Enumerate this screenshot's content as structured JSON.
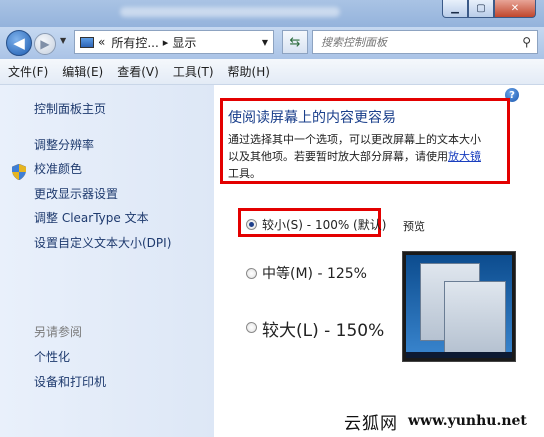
{
  "address": {
    "overflow": "«",
    "crumbs": [
      "所有控...",
      "显示"
    ]
  },
  "search": {
    "placeholder": "搜索控制面板"
  },
  "menu": [
    "文件(F)",
    "编辑(E)",
    "查看(V)",
    "工具(T)",
    "帮助(H)"
  ],
  "sidebar": {
    "items": [
      "控制面板主页",
      "调整分辨率",
      "校准颜色",
      "更改显示器设置",
      "调整 ClearType 文本",
      "设置自定义文本大小(DPI)"
    ],
    "see_also_title": "另请参阅",
    "see_also": [
      "个性化",
      "设备和打印机"
    ]
  },
  "main": {
    "heading": "使阅读屏幕上的内容更容易",
    "desc_line1": "通过选择其中一个选项，可以更改屏幕上的文本大小",
    "desc_line2a": "以及其他项。若要暂时放大部分屏幕，请使用",
    "desc_link": "放大镜",
    "desc_line3": "工具。",
    "preview_label": "预览",
    "options": [
      {
        "label": "较小(S) - 100% (默认)",
        "selected": true
      },
      {
        "label": "中等(M) - 125%",
        "selected": false
      },
      {
        "label": "较大(L) - 150%",
        "selected": false
      }
    ]
  },
  "watermark": {
    "cn": "云狐网",
    "url": "www.yunhu.net"
  },
  "colors": {
    "highlight": "#e30000",
    "link": "#1a3fbf",
    "heading": "#1a3f8b"
  }
}
